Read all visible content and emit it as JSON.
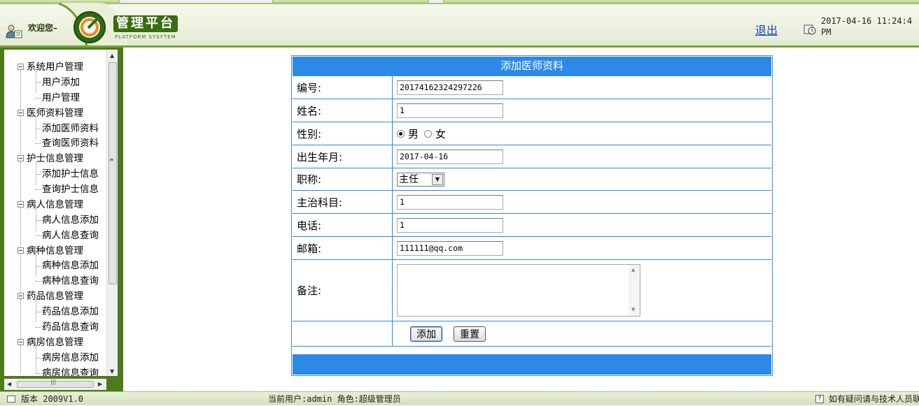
{
  "header": {
    "welcome": "欢迎您–",
    "brand": "管理平台",
    "brand_sub": "PLATFORM SYSYTEM",
    "logout": "退出",
    "datetime": "2017-04-16 11:24:4\nPM"
  },
  "sidebar": {
    "groups": [
      {
        "label": "系统用户管理",
        "items": [
          "用户添加",
          "用户管理"
        ]
      },
      {
        "label": "医师资料管理",
        "items": [
          "添加医师资料",
          "查询医师资料"
        ]
      },
      {
        "label": "护士信息管理",
        "items": [
          "添加护士信息",
          "查询护士信息"
        ]
      },
      {
        "label": "病人信息管理",
        "items": [
          "病人信息添加",
          "病人信息查询"
        ]
      },
      {
        "label": "病种信息管理",
        "items": [
          "病种信息添加",
          "病种信息查询"
        ]
      },
      {
        "label": "药品信息管理",
        "items": [
          "药品信息添加",
          "药品信息查询"
        ]
      },
      {
        "label": "病房信息管理",
        "items": [
          "病房信息添加",
          "病房信息查询"
        ]
      }
    ]
  },
  "form": {
    "title": "添加医师资料",
    "fields": {
      "id": {
        "label": "编号:",
        "value": "20174162324297226"
      },
      "name": {
        "label": "姓名:",
        "value": "1"
      },
      "gender": {
        "label": "性别:",
        "options": [
          "男",
          "女"
        ],
        "selected": "男"
      },
      "birth": {
        "label": "出生年月:",
        "value": "2017-04-16"
      },
      "title": {
        "label": "职称:",
        "value": "主任"
      },
      "dept": {
        "label": "主治科目:",
        "value": "1"
      },
      "phone": {
        "label": "电话:",
        "value": "1"
      },
      "email": {
        "label": "邮箱:",
        "value": "111111@qq.com"
      },
      "remark": {
        "label": "备注:",
        "value": ""
      }
    },
    "buttons": {
      "add": "添加",
      "reset": "重置"
    }
  },
  "status": {
    "version": "版本 2009V1.0",
    "current_user": "当前用户:admin 角色:超级管理员",
    "help": "如有疑问请与技术人员联系"
  },
  "colors": {
    "accent": "#2c8ae6",
    "sidebar": "#4f7a1c",
    "brand": "#3a6d12"
  }
}
